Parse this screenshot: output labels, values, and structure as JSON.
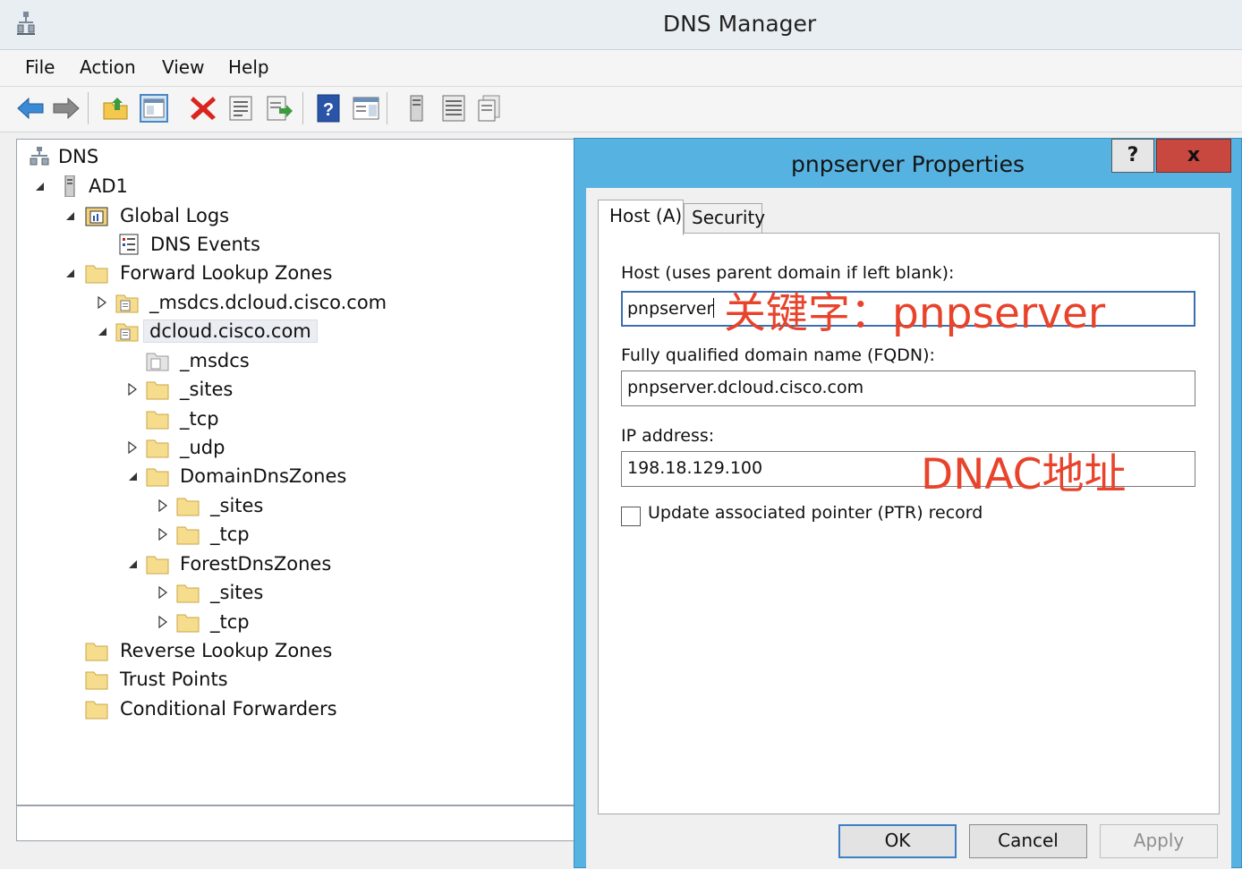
{
  "window": {
    "title": "DNS Manager"
  },
  "menu": [
    "File",
    "Action",
    "View",
    "Help"
  ],
  "toolbar": {
    "buttons": [
      "back-icon",
      "forward-icon",
      "up-level-icon",
      "show-hide-tree-icon",
      "delete-icon",
      "properties-icon",
      "export-list-icon",
      "help-icon",
      "action-pane-icon",
      "server-icon",
      "list-icon",
      "detail-icon"
    ]
  },
  "tree": {
    "root": "DNS",
    "server": "AD1",
    "global_logs": "Global Logs",
    "dns_events": "DNS Events",
    "forward_zones": "Forward Lookup Zones",
    "msdcs_zone": "_msdcs.dcloud.cisco.com",
    "dcloud_zone": "dcloud.cisco.com",
    "msdcs": "_msdcs",
    "sites": "_sites",
    "tcp": "_tcp",
    "udp": "_udp",
    "domain_dns_zones": "DomainDnsZones",
    "domain_sites": "_sites",
    "domain_tcp": "_tcp",
    "forest_dns_zones": "ForestDnsZones",
    "forest_sites": "_sites",
    "forest_tcp": "_tcp",
    "reverse_zones": "Reverse Lookup Zones",
    "trust_points": "Trust Points",
    "conditional_forwarders": "Conditional Forwarders"
  },
  "dialog": {
    "title": "pnpserver Properties",
    "help_label": "?",
    "close_label": "x",
    "tabs": [
      "Host (A)",
      "Security"
    ],
    "host_label": "Host (uses parent domain if left blank):",
    "host_value": "pnpserver",
    "fqdn_label": "Fully qualified domain name (FQDN):",
    "fqdn_value": "pnpserver.dcloud.cisco.com",
    "ip_label": "IP address:",
    "ip_value": "198.18.129.100",
    "ptr_label": "Update associated pointer (PTR) record",
    "ptr_checked": false,
    "ok_label": "OK",
    "cancel_label": "Cancel",
    "apply_label": "Apply"
  },
  "annotations": {
    "keyword": "关键字：pnpserver",
    "dnac": "DNAC地址",
    "color": "#e8432b"
  }
}
